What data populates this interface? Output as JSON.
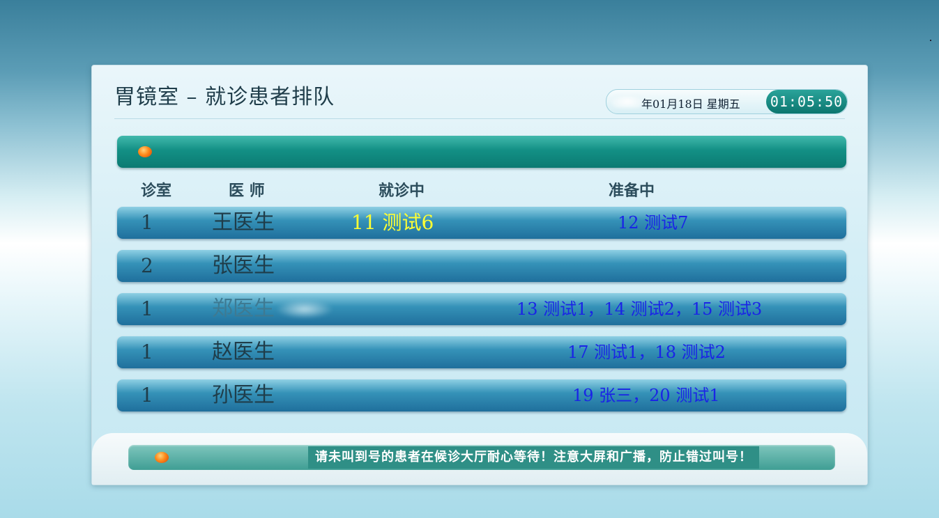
{
  "screen": {
    "title": "胃镜室 – 就诊患者排队",
    "date_text": "年01月18日 星期五",
    "time": "01:05:50"
  },
  "columns": {
    "room": "诊室",
    "doctor": "医 师",
    "current": "就诊中",
    "waiting": "准备中"
  },
  "rows": [
    {
      "room": "1",
      "doctor": "王医生",
      "current": "11 测试6",
      "waiting": "12 测试7"
    },
    {
      "room": "2",
      "doctor": "张医生",
      "current": "",
      "waiting": ""
    },
    {
      "room": "1",
      "doctor": "郑医生",
      "current": "",
      "waiting": "13 测试1，14 测试2，15 测试3"
    },
    {
      "room": "1",
      "doctor": "赵医生",
      "current": "",
      "waiting": "17 测试1，18 测试2"
    },
    {
      "room": "1",
      "doctor": "孙医生",
      "current": "",
      "waiting": "19 张三，20 测试1"
    }
  ],
  "footer": {
    "notice": "请未叫到号的患者在候诊大厅耐心等待！注意大屏和广播，防止错过叫号！"
  },
  "colors": {
    "banner_teal": "#139085",
    "row_blue": "#3592b8",
    "current_yellow": "#ffff33",
    "waiting_blue": "#1a24e6",
    "indicator_orange": "#ff8a1a"
  }
}
